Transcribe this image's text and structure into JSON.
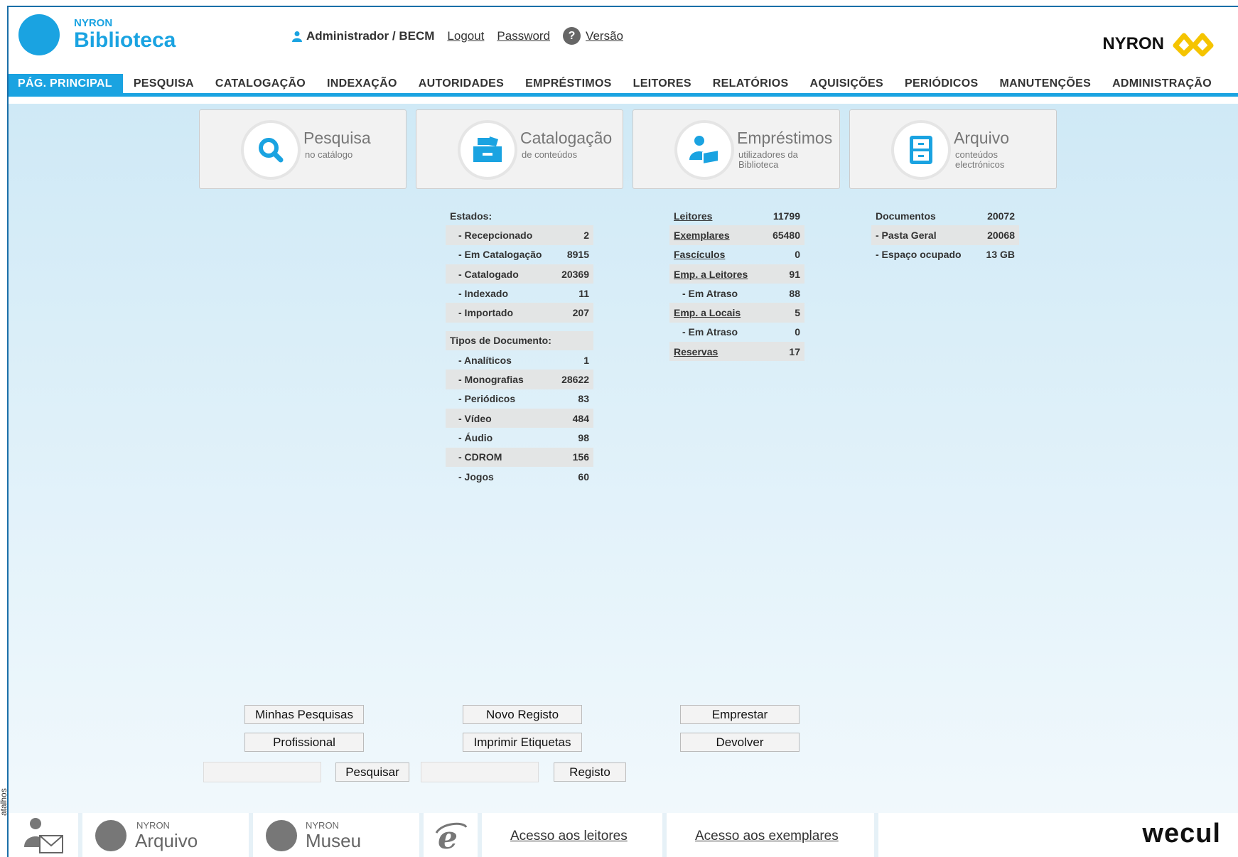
{
  "header": {
    "logo_small": "NYRON",
    "logo_big": "Biblioteca",
    "user": "Administrador / BECM",
    "logout": "Logout",
    "password": "Password",
    "version": "Versão",
    "brand": "NYRON"
  },
  "menu": [
    {
      "label": "PÁG. PRINCIPAL",
      "active": true
    },
    {
      "label": "PESQUISA"
    },
    {
      "label": "CATALOGAÇÃO"
    },
    {
      "label": "INDEXAÇÃO"
    },
    {
      "label": "AUTORIDADES"
    },
    {
      "label": "EMPRÉSTIMOS"
    },
    {
      "label": "LEITORES"
    },
    {
      "label": "RELATÓRIOS"
    },
    {
      "label": "AQUISIÇÕES"
    },
    {
      "label": "PERIÓDICOS"
    },
    {
      "label": "MANUTENÇÕES"
    },
    {
      "label": "ADMINISTRAÇÃO"
    }
  ],
  "tiles": [
    {
      "title": "Pesquisa",
      "subtitle": "no catálogo",
      "icon": "search-icon"
    },
    {
      "title": "Catalogação",
      "subtitle": "de conteúdos",
      "icon": "drawer-icon"
    },
    {
      "title": "Empréstimos",
      "subtitle": "utilizadores da Biblioteca",
      "icon": "reader-icon"
    },
    {
      "title": "Arquivo",
      "subtitle": "conteúdos electrónicos",
      "icon": "cabinet-icon"
    }
  ],
  "catalog_stats": {
    "estados_label": "Estados:",
    "estados": [
      {
        "label": "- Recepcionado",
        "value": "2"
      },
      {
        "label": "- Em Catalogação",
        "value": "8915"
      },
      {
        "label": "- Catalogado",
        "value": "20369"
      },
      {
        "label": "- Indexado",
        "value": "11"
      },
      {
        "label": "- Importado",
        "value": "207"
      }
    ],
    "tipos_label": "Tipos de Documento:",
    "tipos": [
      {
        "label": "- Analíticos",
        "value": "1"
      },
      {
        "label": "- Monografias",
        "value": "28622"
      },
      {
        "label": "- Periódicos",
        "value": "83"
      },
      {
        "label": "- Vídeo",
        "value": "484"
      },
      {
        "label": "- Áudio",
        "value": "98"
      },
      {
        "label": "- CDROM",
        "value": "156"
      },
      {
        "label": "- Jogos",
        "value": "60"
      }
    ]
  },
  "loan_stats": [
    {
      "label": "Leitores",
      "value": "11799",
      "link": true
    },
    {
      "label": "Exemplares",
      "value": "65480",
      "link": true
    },
    {
      "label": "Fascículos",
      "value": "0",
      "link": true
    },
    {
      "label": "Emp. a Leitores",
      "value": "91",
      "link": true
    },
    {
      "label": "- Em Atraso",
      "value": "88",
      "link": false
    },
    {
      "label": "Emp. a Locais",
      "value": "5",
      "link": true
    },
    {
      "label": "- Em Atraso",
      "value": "0",
      "link": false
    },
    {
      "label": "Reservas",
      "value": "17",
      "link": true
    }
  ],
  "archive_stats": [
    {
      "label": "Documentos",
      "value": "20072"
    },
    {
      "label": "- Pasta Geral",
      "value": "20068"
    },
    {
      "label": "- Espaço ocupado",
      "value": "13 GB"
    }
  ],
  "quick": {
    "minhas_pesquisas": "Minhas Pesquisas",
    "profissional": "Profissional",
    "pesquisar": "Pesquisar",
    "novo_registo": "Novo Registo",
    "imprimir_etiquetas": "Imprimir Etiquetas",
    "registo": "Registo",
    "emprestar": "Emprestar",
    "devolver": "Devolver"
  },
  "footer": {
    "side_label": "atalhos",
    "arquivo_small": "NYRON",
    "arquivo_big": "Arquivo",
    "museu_small": "NYRON",
    "museu_big": "Museu",
    "acesso_leitores": "Acesso aos leitores",
    "acesso_exemplares": "Acesso aos exemplares",
    "wecul": "wecul"
  }
}
